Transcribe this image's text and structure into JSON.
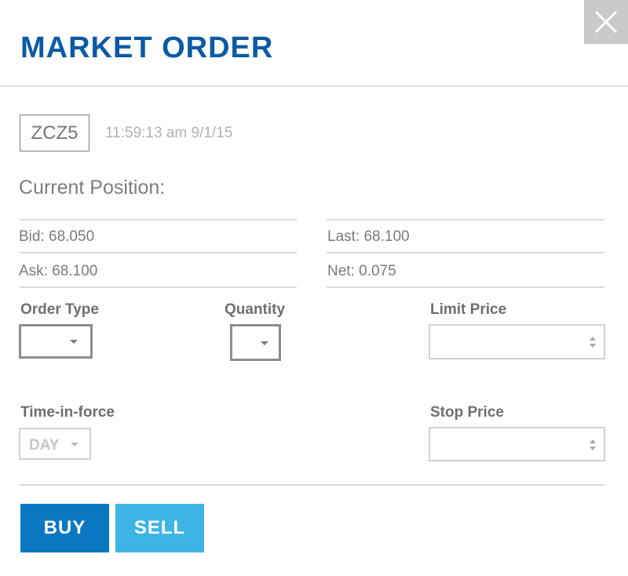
{
  "dialog": {
    "title": "MARKET ORDER",
    "close_icon": "close-icon"
  },
  "instrument": {
    "symbol": "ZCZ5",
    "timestamp": "11:59:13 am 9/1/15"
  },
  "position": {
    "heading": "Current Position:",
    "bid": "Bid: 68.050",
    "ask": "Ask: 68.100",
    "last": "Last: 68.100",
    "net": "Net: 0.075"
  },
  "form": {
    "order_type_label": "Order Type",
    "order_type_value": "",
    "quantity_label": "Quantity",
    "quantity_value": "",
    "limit_price_label": "Limit Price",
    "limit_price_value": "",
    "time_in_force_label": "Time-in-force",
    "time_in_force_value": "DAY",
    "stop_price_label": "Stop Price",
    "stop_price_value": ""
  },
  "actions": {
    "buy_label": "BUY",
    "sell_label": "SELL"
  },
  "colors": {
    "title": "#0b5aa5",
    "buy": "#0a77c2",
    "sell": "#3eb4e5",
    "close_bg": "#c9c9c9"
  }
}
